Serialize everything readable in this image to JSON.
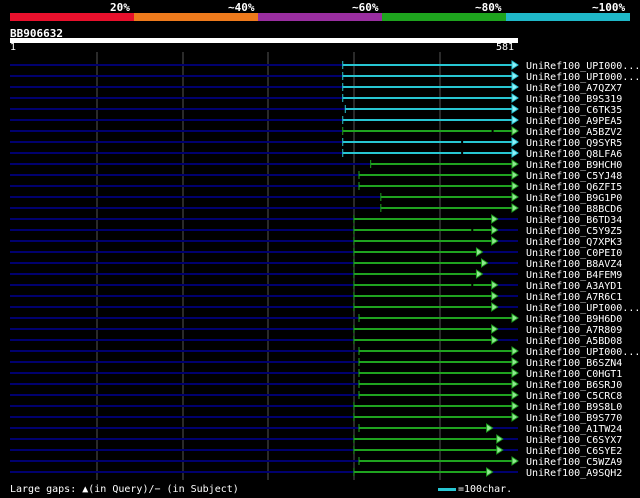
{
  "legend": {
    "labels": [
      "20%",
      "~40%",
      "~60%",
      "~80%",
      "~100%"
    ],
    "colors": [
      "#e8102c",
      "#ee7a1c",
      "#9a2ea0",
      "#1ea41e",
      "#1fb8c8"
    ]
  },
  "query": {
    "name": "BB906632",
    "start": "1",
    "end": "581"
  },
  "hits": [
    {
      "name": "UniRef100_UPI000...",
      "start": 0.655,
      "end": 1.0,
      "color": "cyan",
      "gap": null
    },
    {
      "name": "UniRef100_UPI000...",
      "start": 0.655,
      "end": 1.0,
      "color": "cyan",
      "gap": null
    },
    {
      "name": "UniRef100_A7QZX7",
      "start": 0.655,
      "end": 1.0,
      "color": "cyan",
      "gap": null
    },
    {
      "name": "UniRef100_B9S319",
      "start": 0.655,
      "end": 1.0,
      "color": "cyan",
      "gap": null
    },
    {
      "name": "UniRef100_C6TK35",
      "start": 0.66,
      "end": 1.0,
      "color": "cyan",
      "gap": null
    },
    {
      "name": "UniRef100_A9PEA5",
      "start": 0.655,
      "end": 1.0,
      "color": "cyan",
      "gap": null
    },
    {
      "name": "UniRef100_A5BZV2",
      "start": 0.655,
      "end": 1.0,
      "color": "green",
      "gap": 0.95
    },
    {
      "name": "UniRef100_Q9SYR5",
      "start": 0.655,
      "end": 1.0,
      "color": "cyan",
      "gap": 0.89
    },
    {
      "name": "UniRef100_Q8LFA6",
      "start": 0.655,
      "end": 1.0,
      "color": "cyan",
      "gap": 0.89
    },
    {
      "name": "UniRef100_B9HCH0",
      "start": 0.71,
      "end": 1.0,
      "color": "green",
      "gap": null
    },
    {
      "name": "UniRef100_C5YJ48",
      "start": 0.687,
      "end": 1.0,
      "color": "green",
      "gap": null
    },
    {
      "name": "UniRef100_Q6ZFI5",
      "start": 0.687,
      "end": 1.0,
      "color": "green",
      "gap": null
    },
    {
      "name": "UniRef100_B9G1P0",
      "start": 0.73,
      "end": 1.0,
      "color": "green",
      "gap": null
    },
    {
      "name": "UniRef100_B8BCD6",
      "start": 0.73,
      "end": 1.0,
      "color": "green",
      "gap": null
    },
    {
      "name": "UniRef100_B6TD34",
      "start": 0.677,
      "end": 0.96,
      "color": "green",
      "gap": null
    },
    {
      "name": "UniRef100_C5Y9Z5",
      "start": 0.677,
      "end": 0.96,
      "color": "green",
      "gap": 0.91
    },
    {
      "name": "UniRef100_Q7XPK3",
      "start": 0.677,
      "end": 0.96,
      "color": "green",
      "gap": null
    },
    {
      "name": "UniRef100_C0PEI0",
      "start": 0.677,
      "end": 0.93,
      "color": "green",
      "gap": null
    },
    {
      "name": "UniRef100_B8AVZ4",
      "start": 0.677,
      "end": 0.94,
      "color": "green",
      "gap": null
    },
    {
      "name": "UniRef100_B4FEM9",
      "start": 0.677,
      "end": 0.93,
      "color": "green",
      "gap": null
    },
    {
      "name": "UniRef100_A3AYD1",
      "start": 0.677,
      "end": 0.96,
      "color": "green",
      "gap": 0.91
    },
    {
      "name": "UniRef100_A7R6C1",
      "start": 0.677,
      "end": 0.96,
      "color": "green",
      "gap": null
    },
    {
      "name": "UniRef100_UPI000...",
      "start": 0.677,
      "end": 0.96,
      "color": "green",
      "gap": null
    },
    {
      "name": "UniRef100_B9H6D0",
      "start": 0.687,
      "end": 1.0,
      "color": "green",
      "gap": null
    },
    {
      "name": "UniRef100_A7R809",
      "start": 0.677,
      "end": 0.96,
      "color": "green",
      "gap": null
    },
    {
      "name": "UniRef100_A5BD08",
      "start": 0.677,
      "end": 0.96,
      "color": "green",
      "gap": null
    },
    {
      "name": "UniRef100_UPI000...",
      "start": 0.687,
      "end": 1.0,
      "color": "green",
      "gap": null
    },
    {
      "name": "UniRef100_B6SZN4",
      "start": 0.687,
      "end": 1.0,
      "color": "green",
      "gap": null
    },
    {
      "name": "UniRef100_C0HGT1",
      "start": 0.687,
      "end": 1.0,
      "color": "green",
      "gap": null
    },
    {
      "name": "UniRef100_B6SRJ0",
      "start": 0.687,
      "end": 1.0,
      "color": "green",
      "gap": null
    },
    {
      "name": "UniRef100_C5CRC8",
      "start": 0.687,
      "end": 1.0,
      "color": "green",
      "gap": null
    },
    {
      "name": "UniRef100_B9S8L0",
      "start": 0.677,
      "end": 1.0,
      "color": "green",
      "gap": null
    },
    {
      "name": "UniRef100_B9S770",
      "start": 0.677,
      "end": 1.0,
      "color": "green",
      "gap": null
    },
    {
      "name": "UniRef100_A1TW24",
      "start": 0.687,
      "end": 0.95,
      "color": "green",
      "gap": null
    },
    {
      "name": "UniRef100_C6SYX7",
      "start": 0.677,
      "end": 0.97,
      "color": "green",
      "gap": null
    },
    {
      "name": "UniRef100_C6SYE2",
      "start": 0.677,
      "end": 0.97,
      "color": "green",
      "gap": null
    },
    {
      "name": "UniRef100_C5WZA9",
      "start": 0.687,
      "end": 1.0,
      "color": "green",
      "gap": null
    },
    {
      "name": "UniRef100_A9SQH2",
      "start": 0.677,
      "end": 0.95,
      "color": "green",
      "gap": null
    }
  ],
  "colors": {
    "cyan": "#27c6d3",
    "green": "#1fa31f",
    "track": "#00006e",
    "grid": "#555555"
  },
  "footer": {
    "gaps_text": "Large gaps: ▲(in Query)/− (in Subject)",
    "scale_text": "=100char."
  }
}
